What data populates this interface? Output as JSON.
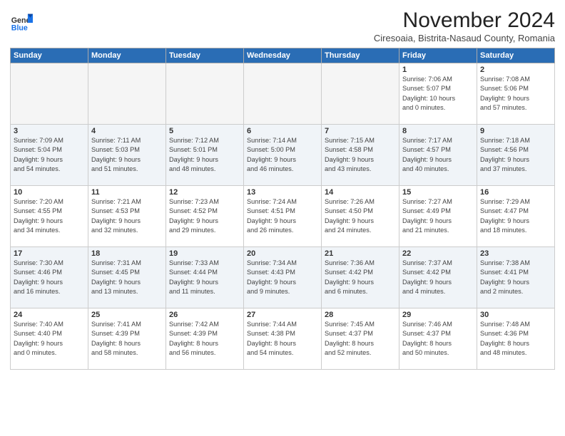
{
  "logo": {
    "general": "General",
    "blue": "Blue"
  },
  "header": {
    "title": "November 2024",
    "subtitle": "Ciresoaia, Bistrita-Nasaud County, Romania"
  },
  "weekdays": [
    "Sunday",
    "Monday",
    "Tuesday",
    "Wednesday",
    "Thursday",
    "Friday",
    "Saturday"
  ],
  "weeks": [
    [
      {
        "day": "",
        "detail": ""
      },
      {
        "day": "",
        "detail": ""
      },
      {
        "day": "",
        "detail": ""
      },
      {
        "day": "",
        "detail": ""
      },
      {
        "day": "",
        "detail": ""
      },
      {
        "day": "1",
        "detail": "Sunrise: 7:06 AM\nSunset: 5:07 PM\nDaylight: 10 hours\nand 0 minutes."
      },
      {
        "day": "2",
        "detail": "Sunrise: 7:08 AM\nSunset: 5:06 PM\nDaylight: 9 hours\nand 57 minutes."
      }
    ],
    [
      {
        "day": "3",
        "detail": "Sunrise: 7:09 AM\nSunset: 5:04 PM\nDaylight: 9 hours\nand 54 minutes."
      },
      {
        "day": "4",
        "detail": "Sunrise: 7:11 AM\nSunset: 5:03 PM\nDaylight: 9 hours\nand 51 minutes."
      },
      {
        "day": "5",
        "detail": "Sunrise: 7:12 AM\nSunset: 5:01 PM\nDaylight: 9 hours\nand 48 minutes."
      },
      {
        "day": "6",
        "detail": "Sunrise: 7:14 AM\nSunset: 5:00 PM\nDaylight: 9 hours\nand 46 minutes."
      },
      {
        "day": "7",
        "detail": "Sunrise: 7:15 AM\nSunset: 4:58 PM\nDaylight: 9 hours\nand 43 minutes."
      },
      {
        "day": "8",
        "detail": "Sunrise: 7:17 AM\nSunset: 4:57 PM\nDaylight: 9 hours\nand 40 minutes."
      },
      {
        "day": "9",
        "detail": "Sunrise: 7:18 AM\nSunset: 4:56 PM\nDaylight: 9 hours\nand 37 minutes."
      }
    ],
    [
      {
        "day": "10",
        "detail": "Sunrise: 7:20 AM\nSunset: 4:55 PM\nDaylight: 9 hours\nand 34 minutes."
      },
      {
        "day": "11",
        "detail": "Sunrise: 7:21 AM\nSunset: 4:53 PM\nDaylight: 9 hours\nand 32 minutes."
      },
      {
        "day": "12",
        "detail": "Sunrise: 7:23 AM\nSunset: 4:52 PM\nDaylight: 9 hours\nand 29 minutes."
      },
      {
        "day": "13",
        "detail": "Sunrise: 7:24 AM\nSunset: 4:51 PM\nDaylight: 9 hours\nand 26 minutes."
      },
      {
        "day": "14",
        "detail": "Sunrise: 7:26 AM\nSunset: 4:50 PM\nDaylight: 9 hours\nand 24 minutes."
      },
      {
        "day": "15",
        "detail": "Sunrise: 7:27 AM\nSunset: 4:49 PM\nDaylight: 9 hours\nand 21 minutes."
      },
      {
        "day": "16",
        "detail": "Sunrise: 7:29 AM\nSunset: 4:47 PM\nDaylight: 9 hours\nand 18 minutes."
      }
    ],
    [
      {
        "day": "17",
        "detail": "Sunrise: 7:30 AM\nSunset: 4:46 PM\nDaylight: 9 hours\nand 16 minutes."
      },
      {
        "day": "18",
        "detail": "Sunrise: 7:31 AM\nSunset: 4:45 PM\nDaylight: 9 hours\nand 13 minutes."
      },
      {
        "day": "19",
        "detail": "Sunrise: 7:33 AM\nSunset: 4:44 PM\nDaylight: 9 hours\nand 11 minutes."
      },
      {
        "day": "20",
        "detail": "Sunrise: 7:34 AM\nSunset: 4:43 PM\nDaylight: 9 hours\nand 9 minutes."
      },
      {
        "day": "21",
        "detail": "Sunrise: 7:36 AM\nSunset: 4:42 PM\nDaylight: 9 hours\nand 6 minutes."
      },
      {
        "day": "22",
        "detail": "Sunrise: 7:37 AM\nSunset: 4:42 PM\nDaylight: 9 hours\nand 4 minutes."
      },
      {
        "day": "23",
        "detail": "Sunrise: 7:38 AM\nSunset: 4:41 PM\nDaylight: 9 hours\nand 2 minutes."
      }
    ],
    [
      {
        "day": "24",
        "detail": "Sunrise: 7:40 AM\nSunset: 4:40 PM\nDaylight: 9 hours\nand 0 minutes."
      },
      {
        "day": "25",
        "detail": "Sunrise: 7:41 AM\nSunset: 4:39 PM\nDaylight: 8 hours\nand 58 minutes."
      },
      {
        "day": "26",
        "detail": "Sunrise: 7:42 AM\nSunset: 4:39 PM\nDaylight: 8 hours\nand 56 minutes."
      },
      {
        "day": "27",
        "detail": "Sunrise: 7:44 AM\nSunset: 4:38 PM\nDaylight: 8 hours\nand 54 minutes."
      },
      {
        "day": "28",
        "detail": "Sunrise: 7:45 AM\nSunset: 4:37 PM\nDaylight: 8 hours\nand 52 minutes."
      },
      {
        "day": "29",
        "detail": "Sunrise: 7:46 AM\nSunset: 4:37 PM\nDaylight: 8 hours\nand 50 minutes."
      },
      {
        "day": "30",
        "detail": "Sunrise: 7:48 AM\nSunset: 4:36 PM\nDaylight: 8 hours\nand 48 minutes."
      }
    ]
  ]
}
